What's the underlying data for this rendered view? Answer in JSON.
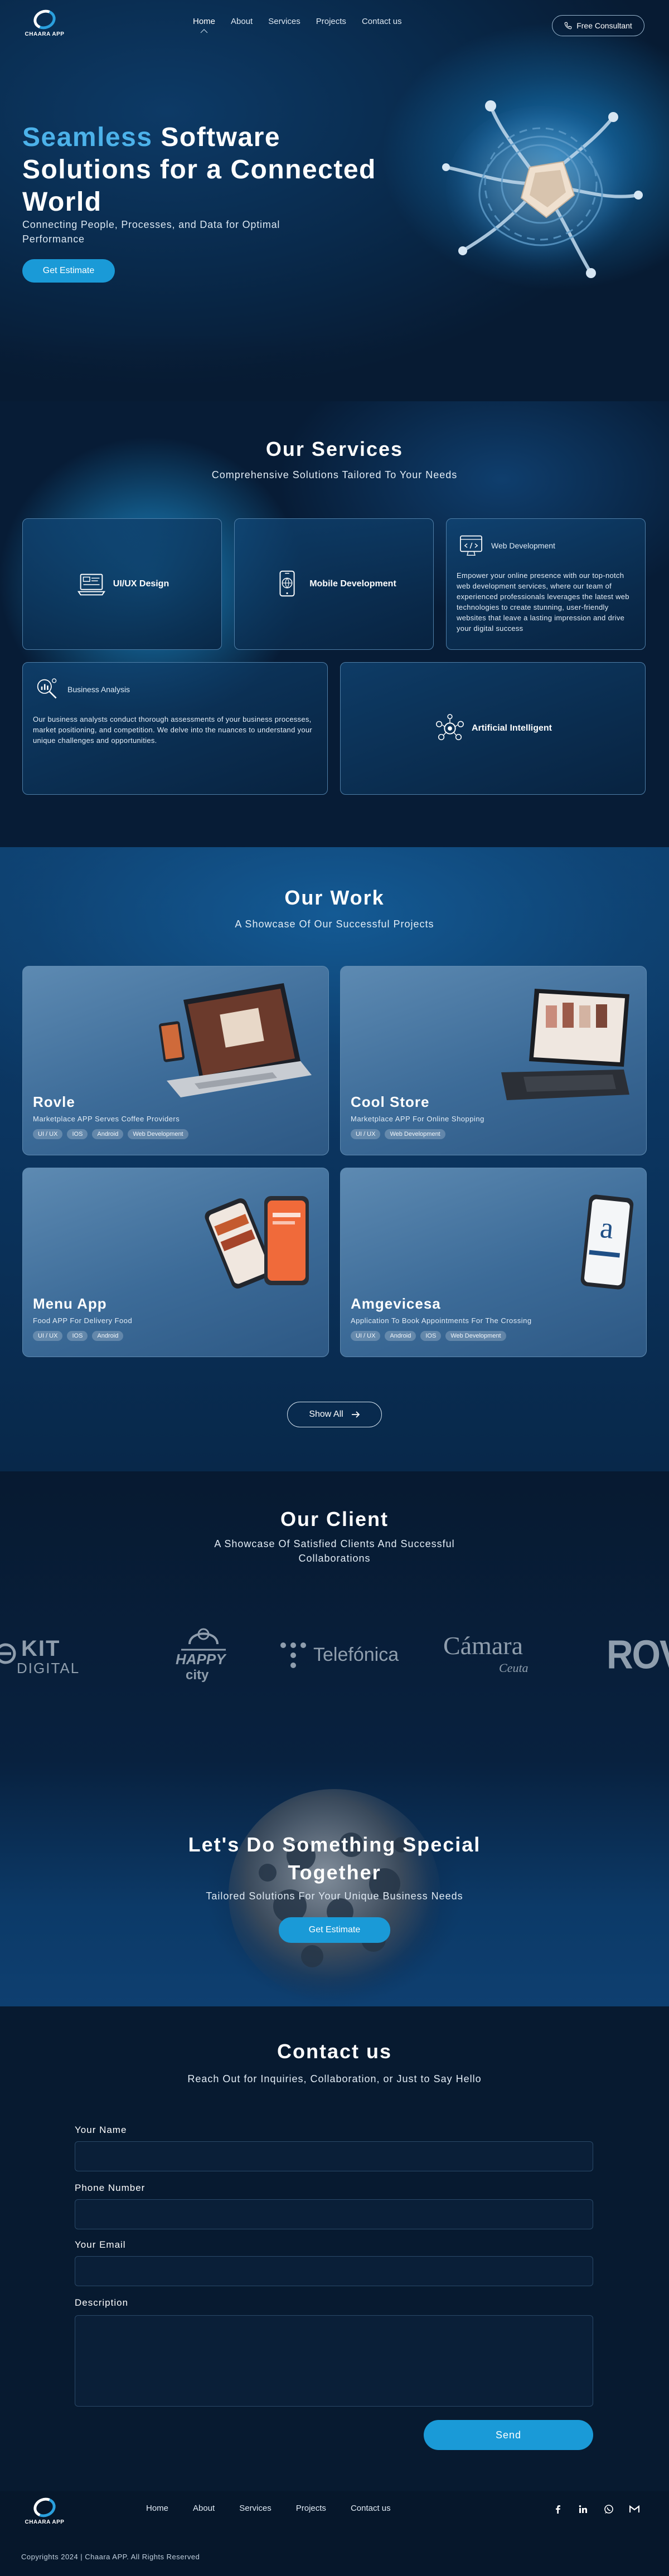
{
  "brand": {
    "name": "CHAARA APP"
  },
  "nav": {
    "links": [
      "Home",
      "About",
      "Services",
      "Projects",
      "Contact us"
    ],
    "active": "Home",
    "consult_label": "Free Consultant"
  },
  "hero": {
    "title_accent": "Seamless",
    "title_rest": "Software Solutions for a Connected World",
    "subtitle": "Connecting People, Processes, and Data for Optimal Performance",
    "cta": "Get Estimate"
  },
  "services": {
    "title": "Our Services",
    "subtitle": "Comprehensive Solutions Tailored To Your Needs",
    "items": [
      {
        "name": "UI/UX Design",
        "icon": "ui-design-icon"
      },
      {
        "name": "Mobile Development",
        "icon": "mobile-dev-icon"
      },
      {
        "name": "Web Development",
        "icon": "web-dev-icon",
        "description": "Empower your online presence with our top-notch web development services, where our team of experienced professionals leverages the latest web technologies to create stunning, user-friendly websites that leave a lasting impression and drive your digital success"
      },
      {
        "name": "Business Analysis",
        "icon": "business-analysis-icon",
        "description": "Our business analysts conduct thorough assessments of your business processes, market positioning, and competition. We delve into the nuances to understand your unique challenges and opportunities."
      },
      {
        "name": "Artificial Intelligent",
        "icon": "ai-icon"
      }
    ]
  },
  "work": {
    "title": "Our Work",
    "subtitle": "A Showcase Of Our Successful Projects",
    "projects": [
      {
        "name": "Rovle",
        "description": "Marketplace APP Serves Coffee Providers",
        "tags": [
          "UI / UX",
          "IOS",
          "Android",
          "Web Development"
        ]
      },
      {
        "name": "Cool Store",
        "description": "Marketplace APP For Online Shopping",
        "tags": [
          "UI / UX",
          "Web Development"
        ]
      },
      {
        "name": "Menu App",
        "description": "Food APP For Delivery Food",
        "tags": [
          "UI / UX",
          "IOS",
          "Android"
        ]
      },
      {
        "name": "Amgevicesa",
        "description": "Application To Book Appointments For The Crossing",
        "tags": [
          "UI / UX",
          "Android",
          "IOS",
          "Web Development"
        ]
      }
    ],
    "show_all": "Show All"
  },
  "clients": {
    "title": "Our Client",
    "subtitle_line1": "A Showcase Of Satisfied Clients And Successful",
    "subtitle_line2": "Collaborations",
    "logos": [
      {
        "line1": "KIT",
        "line2": "DIGITAL"
      },
      {
        "line1": "HAPPY",
        "line2": "city"
      },
      {
        "line1": "Telefónica"
      },
      {
        "line1": "Cámara",
        "line2": "Ceuta"
      },
      {
        "line1": "ROVL"
      }
    ]
  },
  "cta": {
    "title_line1": "Let's Do Something Special",
    "title_line2": "Together",
    "subtitle": "Tailored Solutions For Your Unique Business Needs",
    "button": "Get Estimate"
  },
  "contact": {
    "title": "Contact us",
    "subtitle": "Reach Out for Inquiries, Collaboration, or Just to Say Hello",
    "fields": {
      "name_label": "Your Name",
      "phone_label": "Phone Number",
      "email_label": "Your Email",
      "description_label": "Description"
    },
    "send": "Send"
  },
  "footer": {
    "links": [
      "Home",
      "About",
      "Services",
      "Projects",
      "Contact us"
    ],
    "social": [
      "facebook-icon",
      "linkedin-icon",
      "whatsapp-icon",
      "gmail-icon"
    ],
    "copyright": "Copyrights 2024 | Chaara APP. All Rights Reserved"
  },
  "colors": {
    "accent": "#4cb2ea",
    "button": "#1a9ad7",
    "background": "#071b33"
  }
}
